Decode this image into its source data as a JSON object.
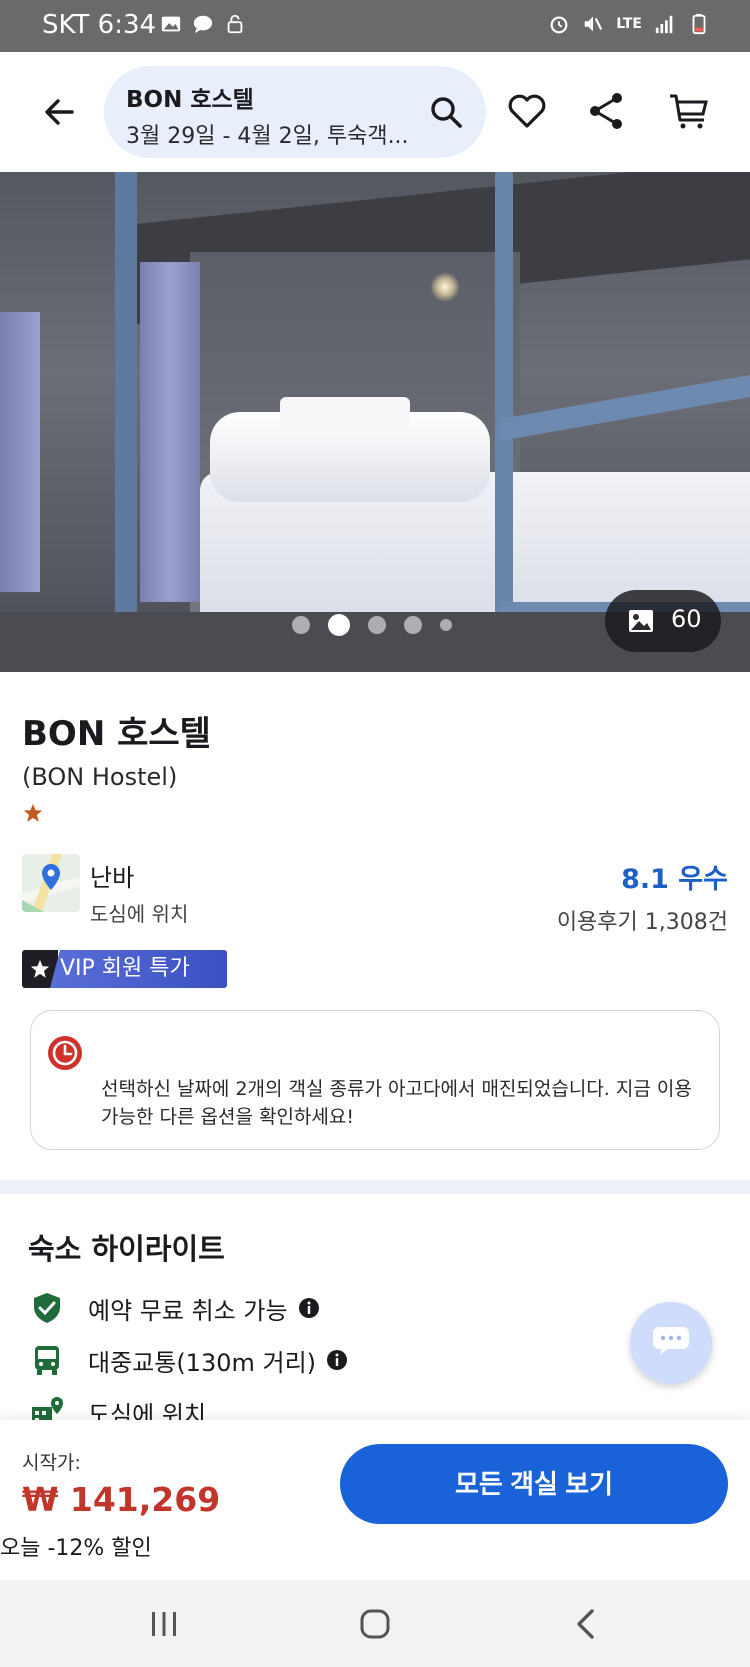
{
  "status_bar": {
    "carrier_time": "SKT 6:34",
    "network": "LTE"
  },
  "header": {
    "hotel_title": "BON 호스텔",
    "dates_summary": "3월 29일 - 4월 2일, 투숙객..."
  },
  "gallery": {
    "photo_count": "60",
    "current_index": 2,
    "total_dots": 5
  },
  "hotel": {
    "name": "BON 호스텔",
    "english_name": "(BON Hostel)",
    "star_rating": 1,
    "area": "난바",
    "area_sub": "도심에 위치",
    "score": "8.1 우수",
    "reviews": "이용후기 1,308건",
    "vip_badge": "VIP 회원 특가"
  },
  "notice": {
    "text": "선택하신 날짜에 2개의 객실 종류가 아고다에서 매진되었습니다. 지금 이용 가능한 다른 옵션을 확인하세요!"
  },
  "highlights": {
    "title": "숙소 하이라이트",
    "items": [
      {
        "label": "예약 무료 취소 가능",
        "icon": "shield-check-icon"
      },
      {
        "label": "대중교통(130m 거리)",
        "icon": "bus-icon"
      },
      {
        "label": "도심에 위치",
        "icon": "city-pin-icon"
      }
    ]
  },
  "bottom_bar": {
    "from_label": "시작가:",
    "price": "₩ 141,269",
    "discount": "오늘 -12% 할인",
    "cta_label": "모든 객실 보기"
  },
  "colors": {
    "accent_blue": "#1a62d8",
    "price_red": "#c2352a",
    "score_blue": "#1b5fc7",
    "highlight_green": "#1f6b3a"
  }
}
